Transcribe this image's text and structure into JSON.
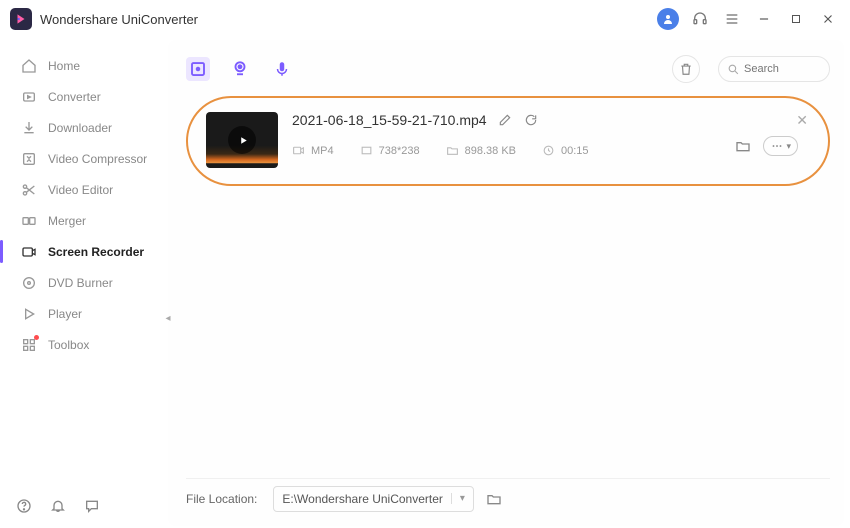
{
  "titlebar": {
    "app_name": "Wondershare UniConverter"
  },
  "sidebar": {
    "items": [
      {
        "label": "Home"
      },
      {
        "label": "Converter"
      },
      {
        "label": "Downloader"
      },
      {
        "label": "Video Compressor"
      },
      {
        "label": "Video Editor"
      },
      {
        "label": "Merger"
      },
      {
        "label": "Screen Recorder"
      },
      {
        "label": "DVD Burner"
      },
      {
        "label": "Player"
      },
      {
        "label": "Toolbox"
      }
    ]
  },
  "toolbar": {
    "search_placeholder": "Search"
  },
  "file": {
    "name": "2021-06-18_15-59-21-710.mp4",
    "format": "MP4",
    "resolution": "738*238",
    "size": "898.38 KB",
    "duration": "00:15"
  },
  "footer": {
    "label": "File Location:",
    "path": "E:\\Wondershare UniConverter"
  }
}
